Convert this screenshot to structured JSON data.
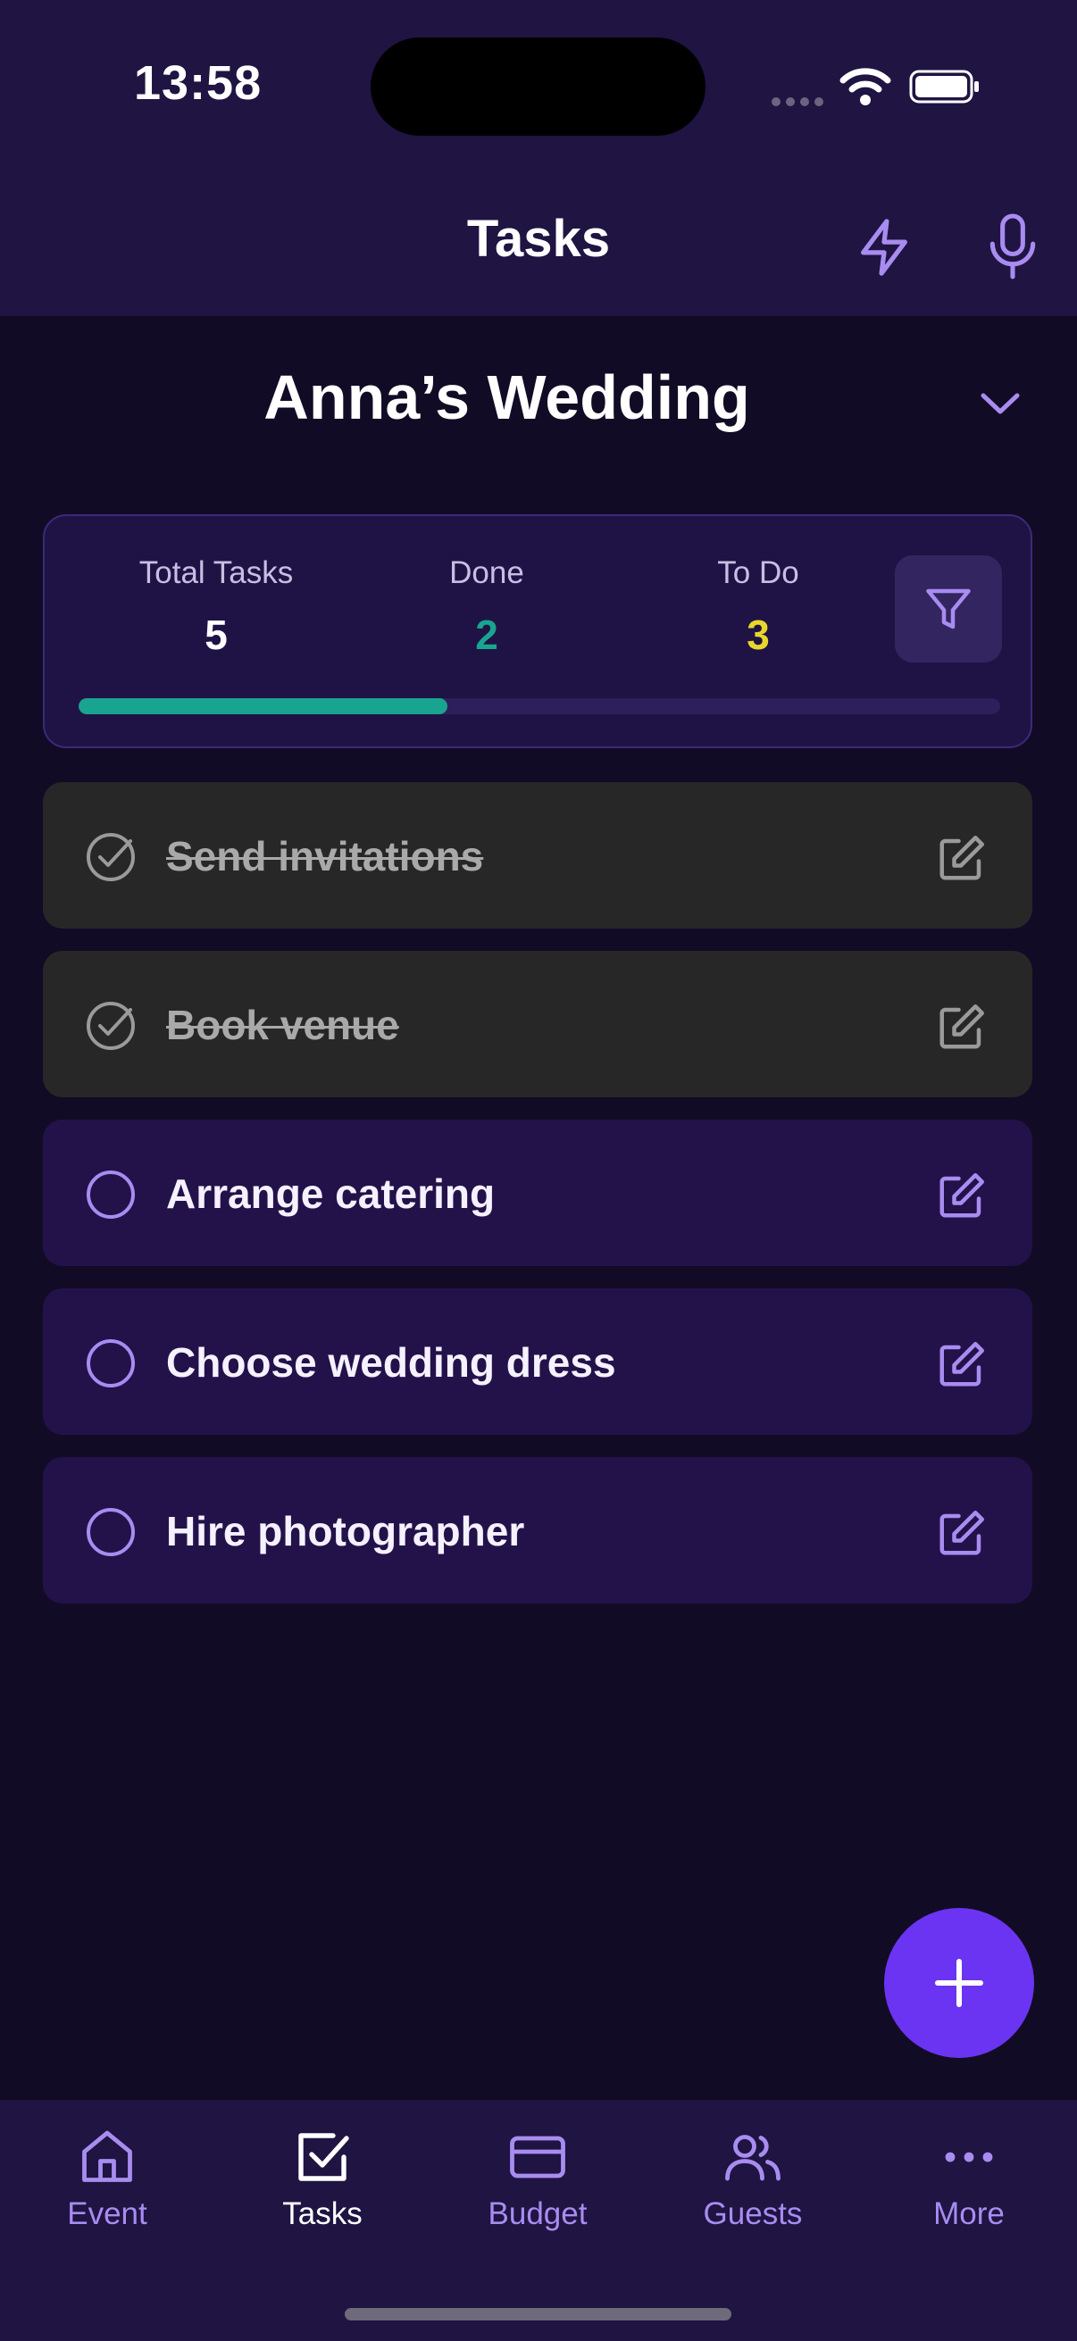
{
  "status_bar": {
    "time": "13:58"
  },
  "header": {
    "title": "Tasks"
  },
  "event": {
    "name": "Anna’s Wedding"
  },
  "stats": {
    "total_label": "Total Tasks",
    "total_value": "5",
    "done_label": "Done",
    "done_value": "2",
    "todo_label": "To Do",
    "todo_value": "3",
    "progress_fraction": 0.4
  },
  "tasks": [
    {
      "label": "Send invitations",
      "done": true
    },
    {
      "label": "Book venue",
      "done": true
    },
    {
      "label": "Arrange catering",
      "done": false
    },
    {
      "label": "Choose wedding dress",
      "done": false
    },
    {
      "label": "Hire photographer",
      "done": false
    }
  ],
  "tabs": [
    {
      "label": "Event",
      "icon": "home-icon",
      "active": false
    },
    {
      "label": "Tasks",
      "icon": "checkbox-icon",
      "active": true
    },
    {
      "label": "Budget",
      "icon": "card-icon",
      "active": false
    },
    {
      "label": "Guests",
      "icon": "users-icon",
      "active": false
    },
    {
      "label": "More",
      "icon": "more-icon",
      "active": false
    }
  ],
  "colors": {
    "accent": "#6b34f2",
    "done_green": "#19a48f",
    "todo_yellow": "#e8d72a",
    "icon_purple": "#a88cf0"
  }
}
